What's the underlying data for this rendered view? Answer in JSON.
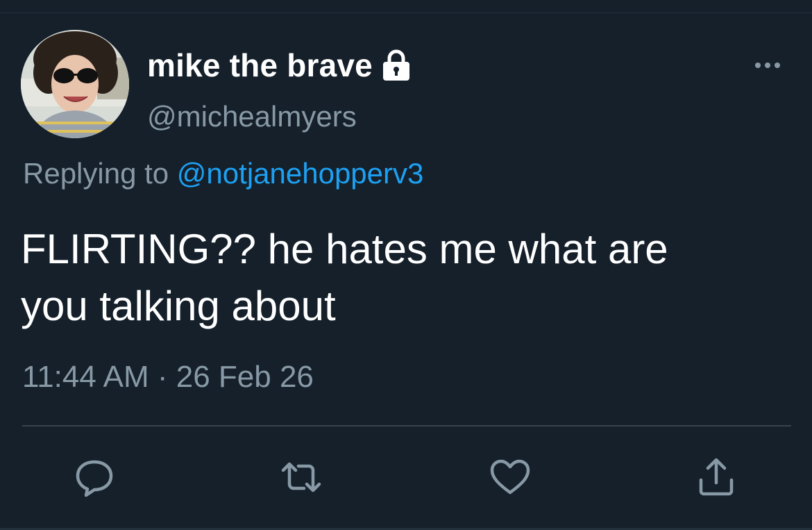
{
  "tweet": {
    "display_name": "mike the brave",
    "handle": "@michealmyers",
    "protected_icon": "lock-icon",
    "reply_prefix": "Replying to ",
    "reply_target": "@notjanehopperv3",
    "text_line1": "FLIRTING?? he hates me what are",
    "text_line2": "you talking about",
    "timestamp": "11:44 AM · 26 Feb 26"
  },
  "actions": [
    {
      "name": "reply",
      "icon": "reply-icon"
    },
    {
      "name": "retweet",
      "icon": "retweet-icon"
    },
    {
      "name": "like",
      "icon": "heart-icon"
    },
    {
      "name": "share",
      "icon": "share-icon"
    }
  ],
  "menu_icon": "more-options-icon",
  "colors": {
    "background": "#15202b",
    "primary_text": "#ffffff",
    "secondary_text": "#8899a6",
    "link": "#1da1f2",
    "icon": "#8899a6",
    "divider": "#38444d"
  }
}
